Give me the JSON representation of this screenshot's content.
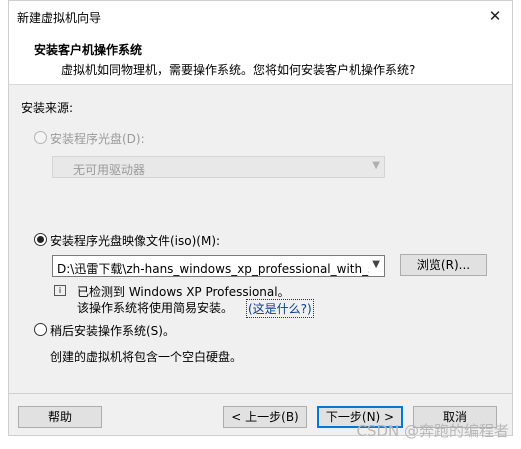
{
  "window": {
    "title": "新建虚拟机向导"
  },
  "header": {
    "title": "安装客户机操作系统",
    "subtitle": "虚拟机如同物理机，需要操作系统。您将如何安装客户机操作系统?"
  },
  "install_source": {
    "label": "安装来源:",
    "disc_option": {
      "label": "安装程序光盘(D):",
      "enabled": false,
      "checked": false
    },
    "disc_drive": {
      "value": "无可用驱动器"
    },
    "iso_option": {
      "label": "安装程序光盘映像文件(iso)(M):",
      "checked": true
    },
    "iso_path": {
      "value": "D:\\迅雷下载\\zh-hans_windows_xp_professional_with_ser"
    },
    "browse_label": "浏览(R)...",
    "detected_line1": "已检测到 Windows XP Professional。",
    "detected_line2": "该操作系统将使用简易安装。",
    "whats_this_link": "(这是什么?)",
    "later_option": {
      "label": "稍后安装操作系统(S)。",
      "checked": false
    },
    "later_desc": "创建的虚拟机将包含一个空白硬盘。"
  },
  "footer": {
    "help_label": "帮助",
    "back_label": "< 上一步(B)",
    "next_label": "下一步(N) >",
    "cancel_label": "取消"
  },
  "watermark": "CSDN @奔跑的编程者"
}
